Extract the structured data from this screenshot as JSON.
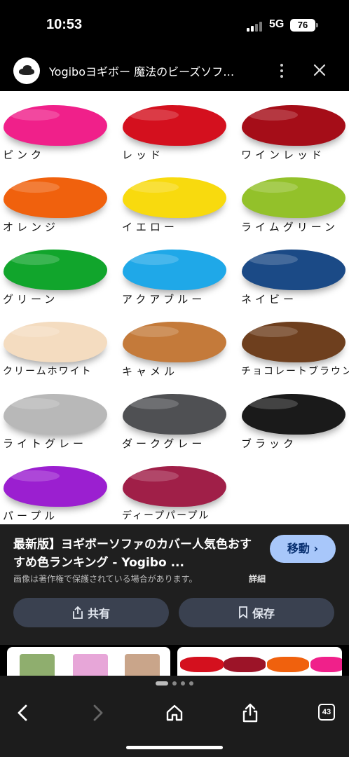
{
  "status": {
    "time": "10:53",
    "network": "5G",
    "battery": "76"
  },
  "header": {
    "title": "Yogiboヨギボー 魔法のビーズソフ…"
  },
  "image": {
    "colors": [
      {
        "label": "ピンク",
        "hex": "#f0208a"
      },
      {
        "label": "レッド",
        "hex": "#d4101e"
      },
      {
        "label": "ワインレッド",
        "hex": "#a50d18"
      },
      {
        "label": "オレンジ",
        "hex": "#f0610d"
      },
      {
        "label": "イエロー",
        "hex": "#f8da0e"
      },
      {
        "label": "ライムグリーン",
        "hex": "#93c12a"
      },
      {
        "label": "グリーン",
        "hex": "#11a52c"
      },
      {
        "label": "アクアブルー",
        "hex": "#1fa8e8"
      },
      {
        "label": "ネイビー",
        "hex": "#1b4a86"
      },
      {
        "label": "クリームホワイト",
        "hex": "#f4dcc0"
      },
      {
        "label": "キャメル",
        "hex": "#c47a3a"
      },
      {
        "label": "チョコレートブラウン",
        "hex": "#6e3f1e"
      },
      {
        "label": "ライトグレー",
        "hex": "#b8b8b8"
      },
      {
        "label": "ダークグレー",
        "hex": "#4f5053"
      },
      {
        "label": "ブラック",
        "hex": "#1a1a1a"
      },
      {
        "label": "パープル",
        "hex": "#9b1fd0"
      },
      {
        "label": "ディープパープル",
        "hex": "#a01f48"
      }
    ]
  },
  "caption": {
    "title": "最新版】ヨギボーソファのカバー人気色おすすめ色ランキング - Yogibo ...",
    "visit_label": "移動",
    "copyright": "画像は著作権で保護されている場合があります。",
    "details_label": "詳細",
    "share_label": "共有",
    "save_label": "保存"
  },
  "bottom": {
    "tab_count": "43"
  }
}
